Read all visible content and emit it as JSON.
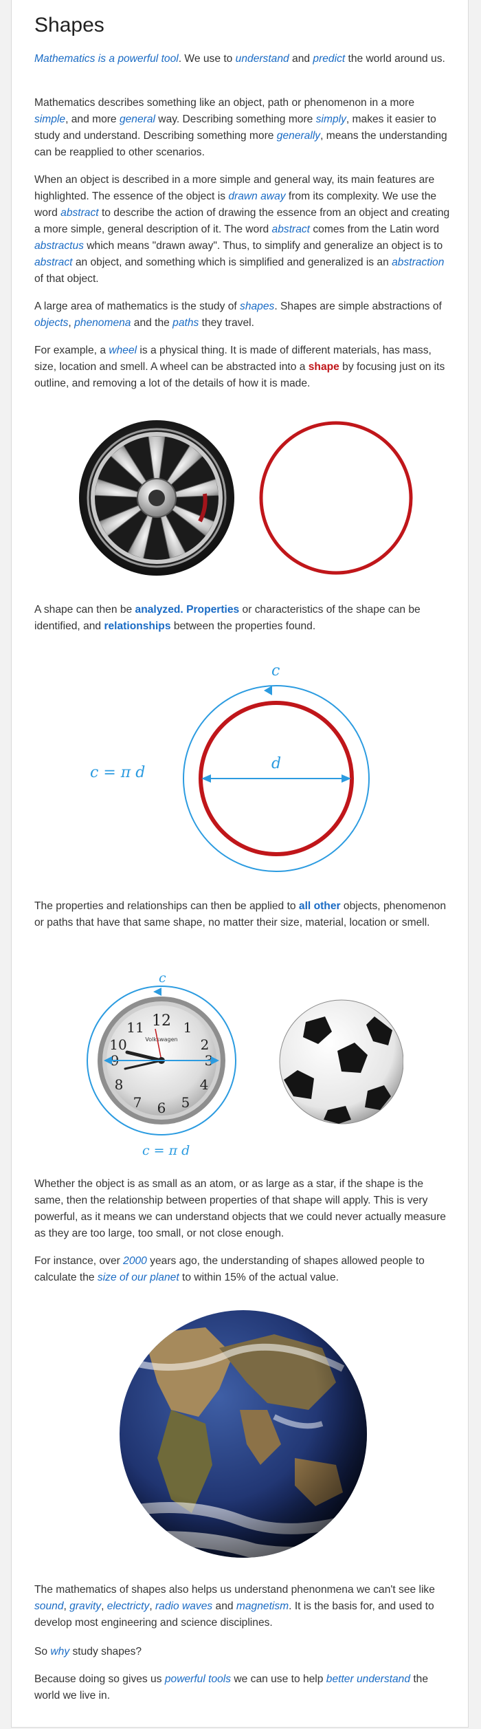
{
  "title": "Shapes",
  "p1": {
    "a": "Mathematics is a powerful tool",
    "b": ". We use to ",
    "c": "understand",
    "d": " and ",
    "e": "predict",
    "f": " the world around us."
  },
  "p2": {
    "a": "Mathematics describes something like an object, path or phenomenon in a more ",
    "b": "simple",
    "c": ", and more ",
    "d": "general",
    "e": " way. Describing something more ",
    "f": "simply",
    "g": ", makes it easier to study and understand. Describing something more ",
    "h": "generally",
    "i": ", means the understanding can be reapplied to other scenarios."
  },
  "p3": {
    "a": "When an object is described in a more simple and general way, its main features are highlighted. The essence of the object is ",
    "b": "drawn away",
    "c": " from its complexity. We use the word ",
    "d": "abstract",
    "e": " to describe the action of drawing the essence from an object and creating a more simple, general description of it. The word ",
    "f": "abstract",
    "g": " comes from the Latin word ",
    "h": "abstractus",
    "i": " which means \"drawn away\". Thus, to simplify and generalize an object is to ",
    "j": "abstract",
    "k": " an object, and something which is simplified and generalized is an ",
    "l": "abstraction",
    "m": " of that object."
  },
  "p4": {
    "a": "A large area of mathematics is the study of ",
    "b": "shapes",
    "c": ". Shapes are simple abstractions of ",
    "d": "objects",
    "e": ", ",
    "f": "phenomena",
    "g": " and the ",
    "h": "paths",
    "i": " they travel."
  },
  "p5": {
    "a": "For example, a ",
    "b": "wheel",
    "c": " is a physical thing. It is made of different materials, has mass, size, location and smell. A wheel can be abstracted into a ",
    "d": "shape",
    "e": " by focusing just on its outline, and removing a lot of the details of how it is made."
  },
  "p6": {
    "a": "A shape can then be ",
    "b": "analyzed.",
    "c": " ",
    "d": "Properties",
    "e": " or characteristics of the shape can be identified, and ",
    "f": "relationships",
    "g": " between the properties found."
  },
  "diagram": {
    "formula": "c = π d",
    "c_label": "c",
    "d_label": "d"
  },
  "p7": {
    "a": "The properties and relationships can then be applied to ",
    "b": "all other",
    "c": " objects, phenomenon or paths that have that same shape, no matter their size, material, location or smell."
  },
  "clock": {
    "c_label": "c",
    "formula": "c = π d",
    "brand": "Volkswagen",
    "numbers": [
      "12",
      "1",
      "2",
      "3",
      "4",
      "5",
      "6",
      "7",
      "8",
      "9",
      "10",
      "11"
    ]
  },
  "p8": {
    "a": "Whether the object is as small as an atom, or as large as a star, if the shape is the same, then the relationship between properties of that shape will apply. This is very powerful, as it means we can understand objects that we could never actually measure as they are too large, too small, or not close enough."
  },
  "p9": {
    "a": "For instance, over ",
    "b": "2000",
    "c": " years ago, the understanding of shapes allowed people to calculate the ",
    "d": "size of our planet",
    "e": " to within 15% of the actual value."
  },
  "p10": {
    "a": "The mathematics of shapes also helps us understand phenonmena we can't see like ",
    "b": "sound",
    "c": ", ",
    "d": "gravity",
    "e": ", ",
    "f": "electricty",
    "g": ", ",
    "h": "radio waves",
    "i": " and ",
    "j": "magnetism",
    "k": ". It is the basis for, and used to develop most engineering and science disciplines."
  },
  "p11": {
    "a": "So ",
    "b": "why",
    "c": " study shapes?"
  },
  "p12": {
    "a": "Because doing so gives us ",
    "b": "powerful tools",
    "c": " we can use to help ",
    "d": "better understand",
    "e": " the world we live in."
  },
  "colors": {
    "link": "#1a6bc4",
    "shape_red": "#c0161a",
    "diagram_blue": "#2b9be0"
  }
}
